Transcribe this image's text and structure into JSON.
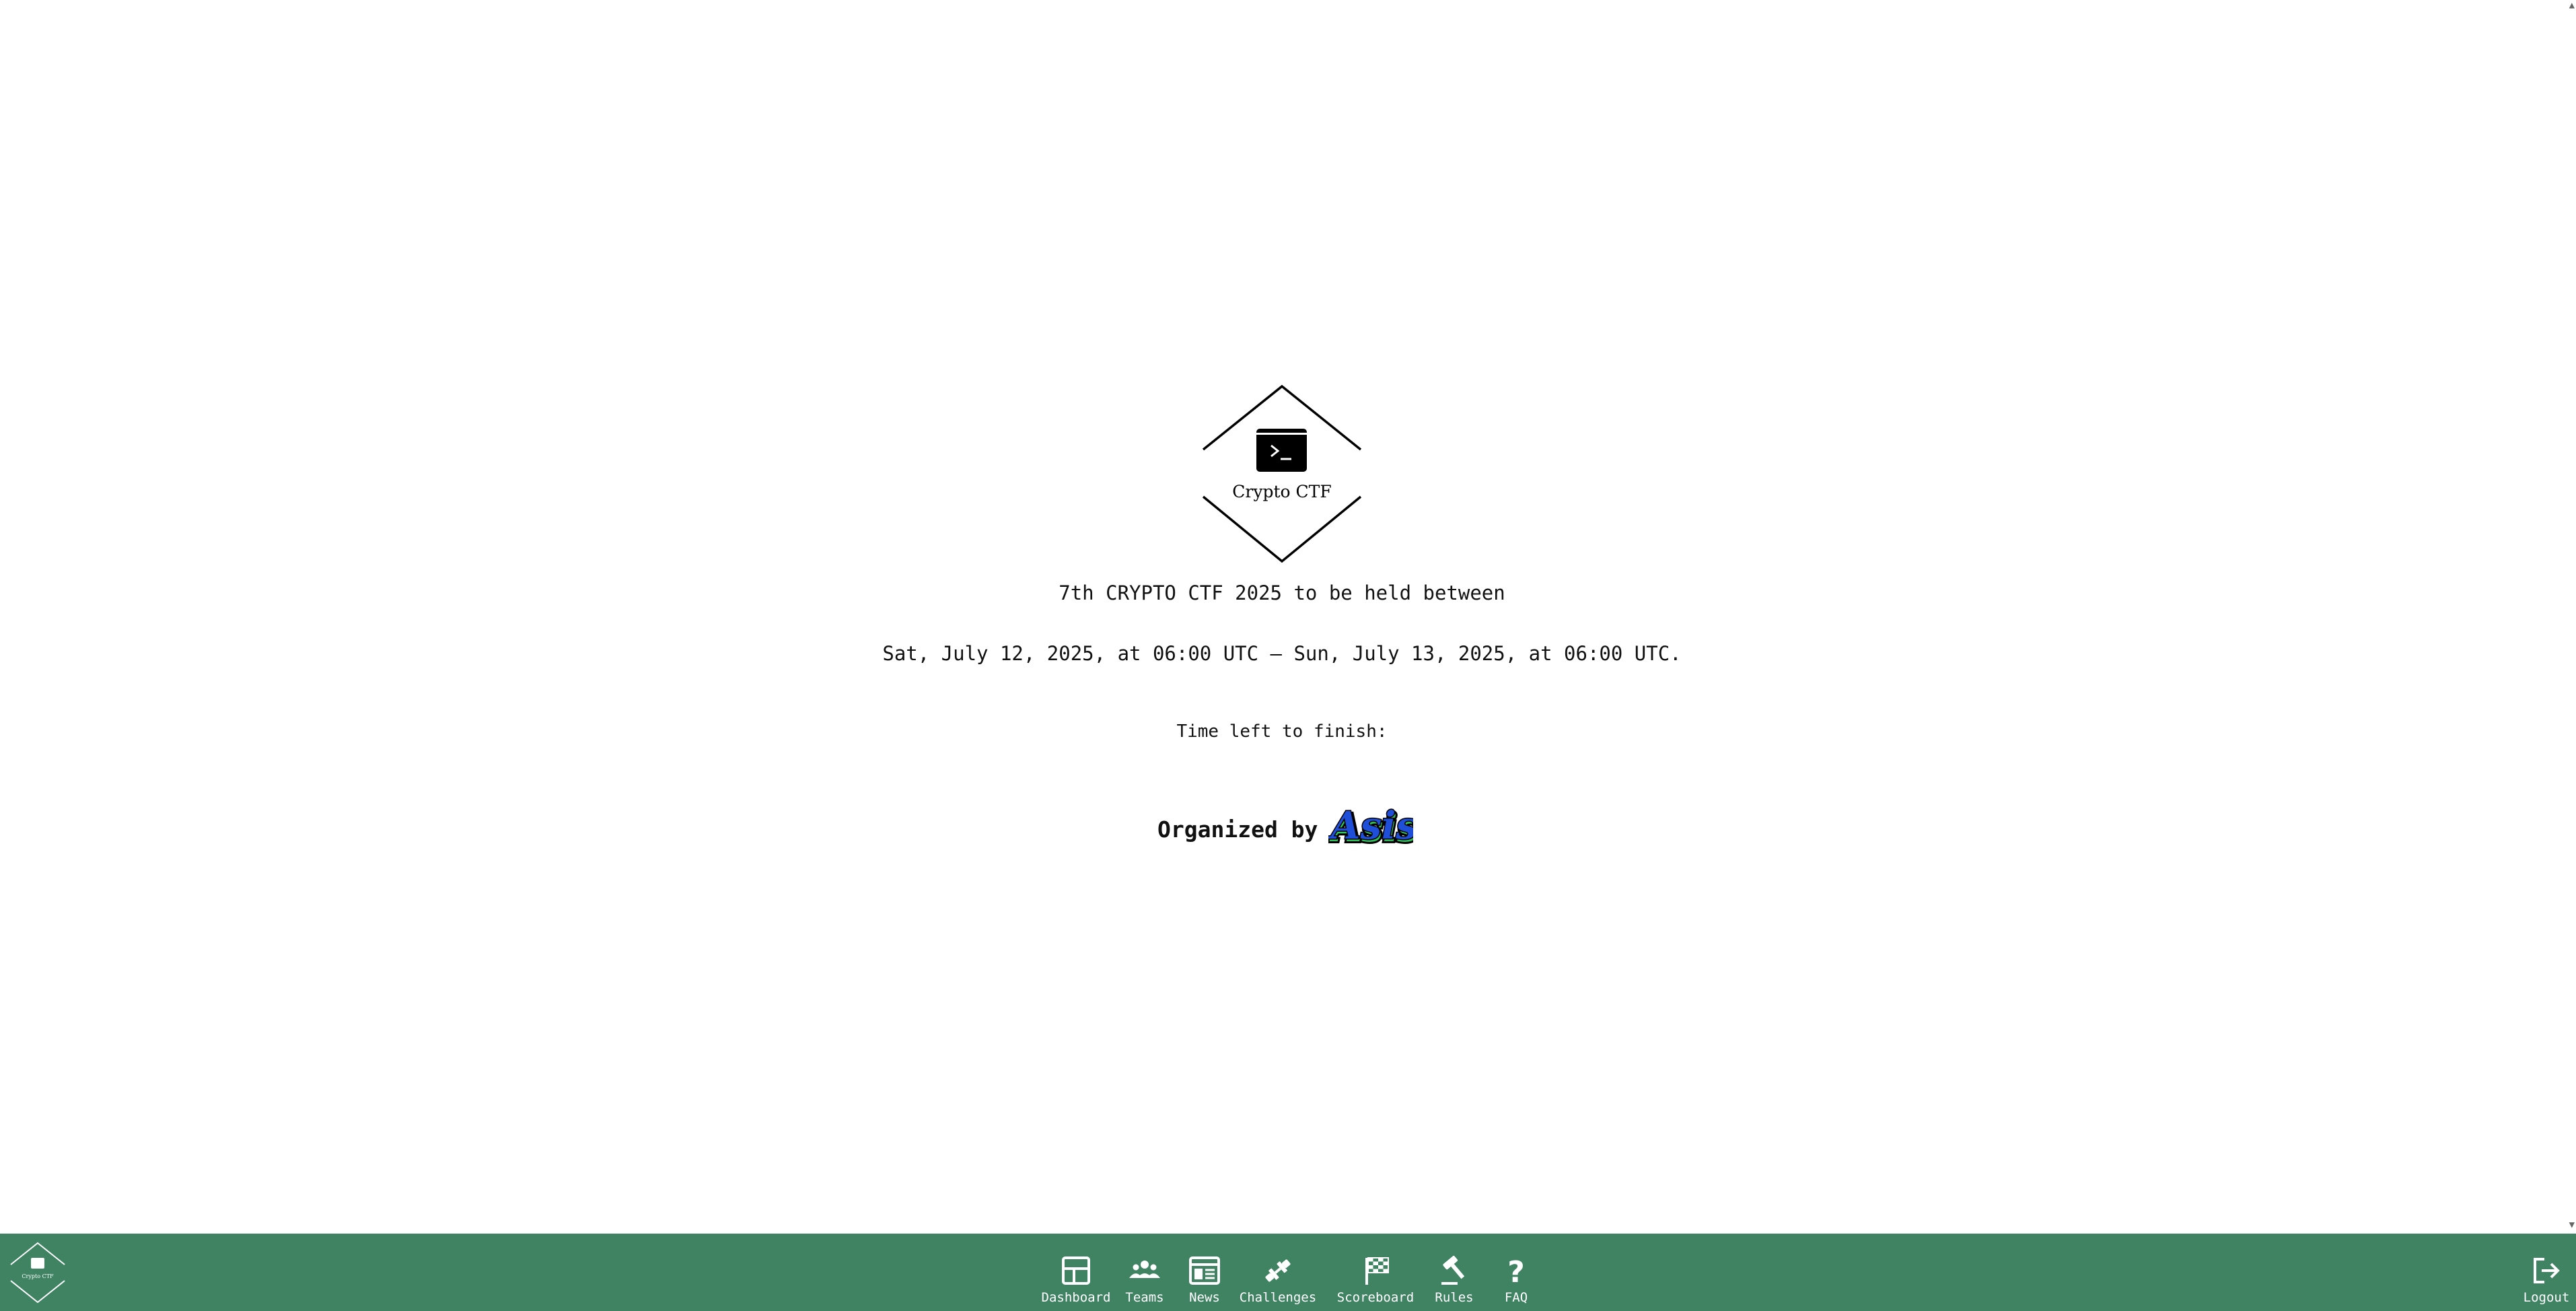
{
  "logo": {
    "caption": "Crypto CTF",
    "icon": "terminal-icon"
  },
  "main": {
    "headline": "7th CRYPTO CTF 2025 to be held between",
    "dates": "Sat, July 12, 2025, at 06:00 UTC — Sun, July 13, 2025, at 06:00 UTC.",
    "time_left_label": "Time left to finish:",
    "organized_by_label": "Organized by",
    "organizer_logo_text": "Asis"
  },
  "nav": {
    "items": [
      {
        "label": "Dashboard",
        "icon": "dashboard-icon"
      },
      {
        "label": "Teams",
        "icon": "teams-icon"
      },
      {
        "label": "News",
        "icon": "news-icon"
      },
      {
        "label": "Challenges",
        "icon": "challenges-icon"
      },
      {
        "label": "Scoreboard",
        "icon": "flag-icon"
      },
      {
        "label": "Rules",
        "icon": "gavel-icon"
      },
      {
        "label": "FAQ",
        "icon": "question-icon"
      }
    ],
    "logout_label": "Logout"
  },
  "colors": {
    "navbar": "#3f8363",
    "text": "#111111",
    "asis_blue": "#1f4fd8",
    "asis_green": "#2fc25a"
  }
}
